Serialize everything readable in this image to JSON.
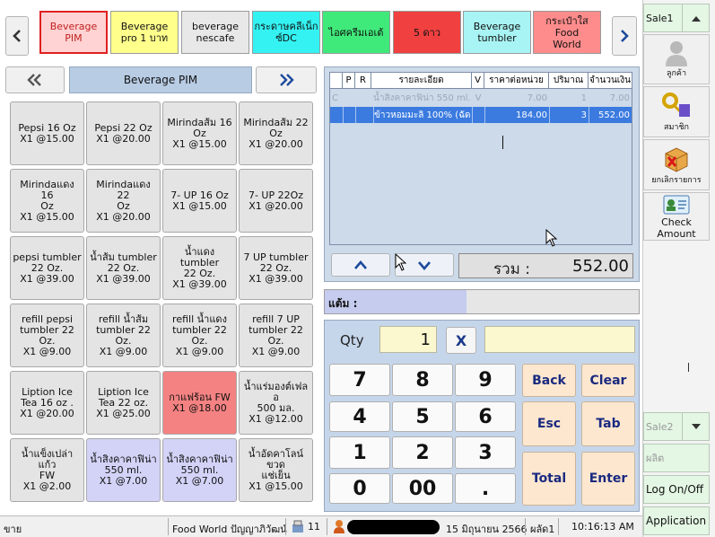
{
  "categories": [
    {
      "label": "Beverage\nPIM",
      "bg": "#ffd3d3",
      "color": "#c02020",
      "border": "#e02020",
      "selected": true
    },
    {
      "label": "Beverage\npro 1 บาท",
      "bg": "#ffff8c",
      "color": "#111111",
      "border": "#9a9a9a",
      "selected": false
    },
    {
      "label": "beverage\nnescafe",
      "bg": "#e8e8e8",
      "color": "#111111",
      "border": "#9a9a9a",
      "selected": false
    },
    {
      "label": "กระดาษคลีเน็ก\nซ์DC",
      "bg": "#34f2f2",
      "color": "#111111",
      "border": "#9a9a9a",
      "selected": false
    },
    {
      "label": "ไอศครีมเอเต้",
      "bg": "#40ea7a",
      "color": "#111111",
      "border": "#9a9a9a",
      "selected": false
    },
    {
      "label": "5 ดาว",
      "bg": "#f04040",
      "color": "#111111",
      "border": "#9a9a9a",
      "selected": false
    },
    {
      "label": "Beverage\ntumbler",
      "bg": "#a8f4f4",
      "color": "#111111",
      "border": "#9a9a9a",
      "selected": false
    },
    {
      "label": "กระเป๋าใส Food\nWorld",
      "bg": "#ff8c8c",
      "color": "#111111",
      "border": "#9a9a9a",
      "selected": false
    }
  ],
  "group_title": "Beverage PIM",
  "products": [
    {
      "label": "Pepsi 16 Oz\nX1 @15.00",
      "bg": "#e4e4e4"
    },
    {
      "label": "Pepsi 22 Oz\nX1 @20.00",
      "bg": "#e4e4e4"
    },
    {
      "label": "Mirindaส้ม 16\nOz\nX1 @15.00",
      "bg": "#e4e4e4"
    },
    {
      "label": "Mirindaส้ม 22\nOz\nX1 @20.00",
      "bg": "#e4e4e4"
    },
    {
      "label": "Mirindaแดง 16\nOz\nX1 @15.00",
      "bg": "#e4e4e4"
    },
    {
      "label": "Mirindaแดง 22\nOz\nX1 @20.00",
      "bg": "#e4e4e4"
    },
    {
      "label": "7- UP 16 Oz\nX1 @15.00",
      "bg": "#e4e4e4"
    },
    {
      "label": "7- UP 22Oz\nX1 @20.00",
      "bg": "#e4e4e4"
    },
    {
      "label": "pepsi tumbler\n22 Oz.\nX1 @39.00",
      "bg": "#e4e4e4"
    },
    {
      "label": "น้ำส้ม tumbler\n22 Oz.\nX1 @39.00",
      "bg": "#e4e4e4"
    },
    {
      "label": "น้ำแดง tumbler\n22 Oz.\nX1 @39.00",
      "bg": "#e4e4e4"
    },
    {
      "label": "7 UP tumbler\n22 Oz.\nX1 @39.00",
      "bg": "#e4e4e4"
    },
    {
      "label": "refill pepsi\ntumbler 22\nOz.\nX1 @9.00",
      "bg": "#e4e4e4"
    },
    {
      "label": "refill น้ำส้ม\ntumbler 22\nOz.\nX1 @9.00",
      "bg": "#e4e4e4"
    },
    {
      "label": "refill น้ำแดง\ntumbler 22\nOz.\nX1 @9.00",
      "bg": "#e4e4e4"
    },
    {
      "label": "refill 7 UP\ntumbler 22 Oz.\nX1 @9.00",
      "bg": "#e4e4e4"
    },
    {
      "label": "Liption Ice\nTea 16 oz .\nX1 @20.00",
      "bg": "#e4e4e4"
    },
    {
      "label": "Liption Ice\nTea 22 oz.\nX1 @25.00",
      "bg": "#e4e4e4"
    },
    {
      "label": "กาแฟร้อน FW\nX1 @18.00",
      "bg": "#f58282"
    },
    {
      "label": "น้ำแร่มองต์เฟลอ\n500 มล.\nX1 @12.00",
      "bg": "#e4e4e4"
    },
    {
      "label": "น้ำแข็งเปล่า แก้ว\nFW\nX1 @2.00",
      "bg": "#e4e4e4"
    },
    {
      "label": "น้ำสิงคาคาฟิน่า\n550 ml.\nX1 @7.00",
      "bg": "#d3d3f8"
    },
    {
      "label": "น้ำสิงคาคาฟิน่า\n550 ml.\nX1 @7.00",
      "bg": "#d3d3f8"
    },
    {
      "label": "น้ำอัดคาโลน์ขวด\nแช่เย็น\nX1 @15.00",
      "bg": "#e4e4e4"
    }
  ],
  "table": {
    "headers": [
      "P",
      "R",
      "รายละเอียด",
      "V",
      "ราคาต่อหน่วย",
      "ปริมาณ",
      "จำนวนเงิน"
    ],
    "rows": [
      {
        "flag": "C",
        "p": "",
        "r": "",
        "desc": "น้ำสิงคาคาฟิน่า 550 ml.",
        "v": "V",
        "price": "7.00",
        "qty": "1",
        "amount": "7.00",
        "style": "cancelled"
      },
      {
        "flag": "",
        "p": "",
        "r": "",
        "desc": "ข้าวหอมมะลิ 100% (ฉัด",
        "v": "",
        "price": "184.00",
        "qty": "3",
        "amount": "552.00",
        "style": "selected"
      }
    ]
  },
  "total_label": "รวม :",
  "total_value": "552.00",
  "points_label": "แต้ม :",
  "points_fraction": 0.45,
  "qty_label": "Qty",
  "qty_value": "1",
  "clear_x": "X",
  "keypad": [
    "7",
    "8",
    "9",
    "4",
    "5",
    "6",
    "1",
    "2",
    "3",
    "0",
    "00",
    "."
  ],
  "func_keys": {
    "back": "Back",
    "clear": "Clear",
    "esc": "Esc",
    "tab": "Tab",
    "total": "Total",
    "enter": "Enter"
  },
  "right_panel": {
    "sale1": "Sale1",
    "customer": "ลูกค้า",
    "member": "สมาชิก",
    "cancel_item": "ยกเลิกรายการ",
    "check_amount": "Check Amount",
    "sale2": "Sale2",
    "product": "ผลิต",
    "logonoff": "Log On/Off",
    "application": "Application"
  },
  "status": {
    "mode": "ขาย",
    "store": "Food World ปัญญาภิวัฒน์",
    "terminal": "11",
    "date": "15 มิถุนายน 2566",
    "shift": "ผลัด1",
    "time": "10:16:13 AM"
  }
}
